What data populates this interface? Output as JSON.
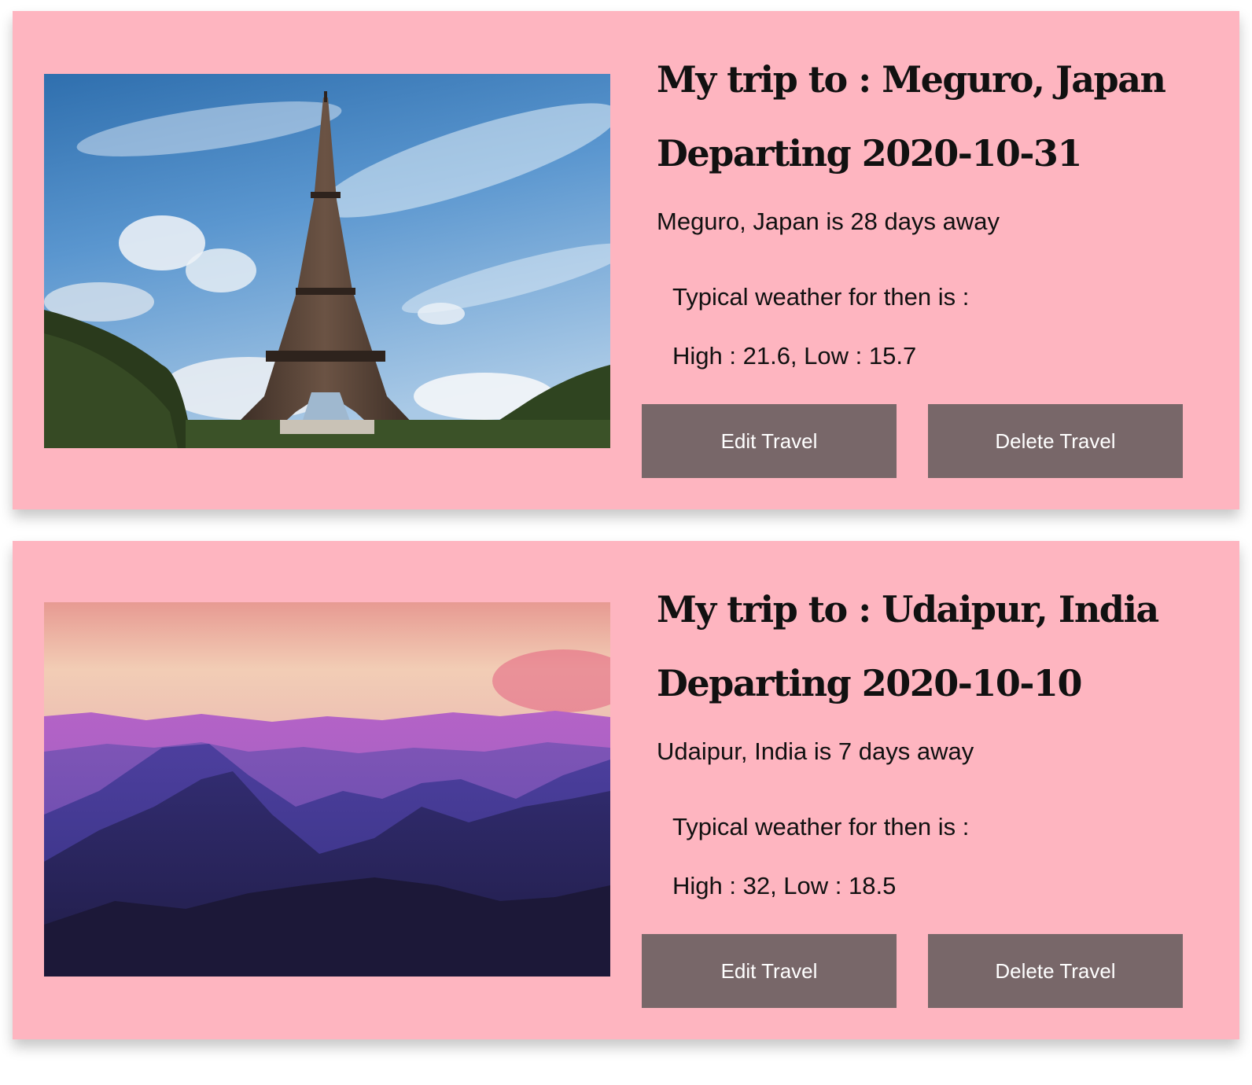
{
  "trips": [
    {
      "title": "My trip to : Meguro, Japan",
      "departing": "Departing 2020-10-31",
      "countdown": "Meguro, Japan is 28 days away",
      "weather_heading": "Typical weather for then is :",
      "weather_values": "High : 21.6, Low : 15.7",
      "edit_label": "Edit Travel",
      "delete_label": "Delete Travel",
      "image": "eiffel-tower-photo"
    },
    {
      "title": "My trip to : Udaipur, India",
      "departing": "Departing 2020-10-10",
      "countdown": "Udaipur, India is 7 days away",
      "weather_heading": "Typical weather for then is :",
      "weather_values": "High : 32, Low : 18.5",
      "edit_label": "Edit Travel",
      "delete_label": "Delete Travel",
      "image": "mountain-sunset-photo"
    }
  ],
  "colors": {
    "card_background": "#feb5c0",
    "button_background": "#786769",
    "button_text": "#ffffff",
    "text": "#111111"
  }
}
